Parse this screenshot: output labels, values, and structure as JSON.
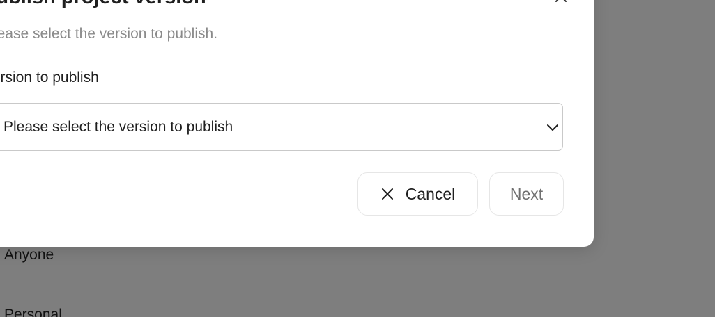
{
  "background": {
    "items": [
      "Anyone",
      "Personal"
    ]
  },
  "dialog": {
    "title": "Publish project version",
    "subtitle": "Please select the version to publish.",
    "field_label": "Version to publish",
    "select_placeholder": "Please select the version to publish",
    "cancel_label": "Cancel",
    "next_label": "Next"
  },
  "icons": {
    "close": "close-icon",
    "chevron": "chevron-down-icon",
    "cancel": "x-icon"
  },
  "colors": {
    "overlay": "#7f7f7f",
    "text_primary": "#1f1f1f",
    "text_muted": "#8a8a8a",
    "border": "#c9c9c9"
  }
}
